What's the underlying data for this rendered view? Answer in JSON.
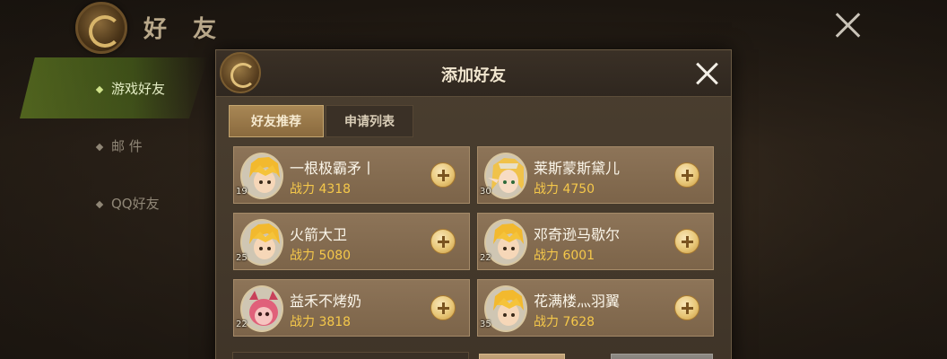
{
  "page": {
    "title": "好 友"
  },
  "sidebar": {
    "items": [
      {
        "label": "游戏好友",
        "active": true
      },
      {
        "label": "邮 件",
        "active": false
      },
      {
        "label": "QQ好友",
        "active": false
      }
    ]
  },
  "dialog": {
    "title": "添加好友",
    "tabs": [
      {
        "label": "好友推荐",
        "active": true
      },
      {
        "label": "申请列表",
        "active": false
      }
    ],
    "players": [
      {
        "name": "一根极霸矛丨",
        "power": "战力 4318",
        "level": "19",
        "avatar": "blonde-boy"
      },
      {
        "name": "莱斯蒙斯黛儿",
        "power": "战力 4750",
        "level": "30",
        "avatar": "elf-girl"
      },
      {
        "name": "火箭大卫",
        "power": "战力 5080",
        "level": "25",
        "avatar": "blonde-boy"
      },
      {
        "name": "邓奇逊马歇尔",
        "power": "战力 6001",
        "level": "22",
        "avatar": "blonde-boy"
      },
      {
        "name": "益禾不烤奶",
        "power": "战力 3818",
        "level": "22",
        "avatar": "pink-imp"
      },
      {
        "name": "花满楼灬羽翼",
        "power": "战力 7628",
        "level": "35",
        "avatar": "blonde-boy"
      }
    ]
  },
  "colors": {
    "accent": "#f5c84a",
    "card": "#8d7458",
    "active_tab": "#a88755"
  }
}
